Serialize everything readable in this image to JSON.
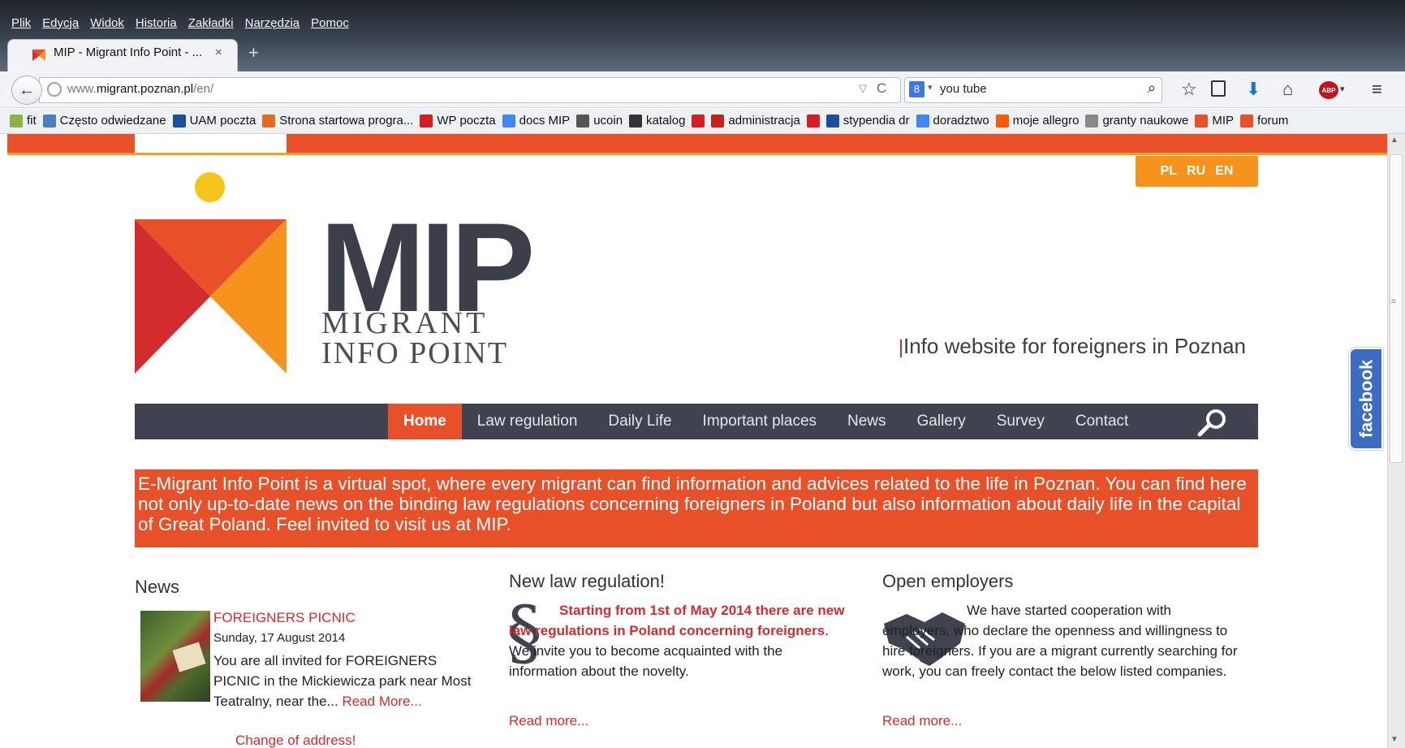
{
  "menubar": [
    "Plik",
    "Edycja",
    "Widok",
    "Historia",
    "Zakładki",
    "Narzędzia",
    "Pomoc"
  ],
  "tab": {
    "title": "MIP - Migrant Info Point - ...",
    "close": "×",
    "new_tab": "+"
  },
  "nav": {
    "back": "←",
    "url_prefix": "www.",
    "url_host": "migrant.poznan.pl",
    "url_path": "/en/",
    "url_dropdown": "▽",
    "reload": "C",
    "search_engine": "8",
    "search_value": "you tube"
  },
  "toolbar_icons": {
    "star": "☆",
    "download": "⬇",
    "home": "⌂",
    "abp": "ABP",
    "menu": "≡",
    "search": "⌕"
  },
  "bookmarks": [
    {
      "label": "fit",
      "color": "#8bb34a"
    },
    {
      "label": "Często odwiedzane",
      "color": "#4a7fc1"
    },
    {
      "label": "UAM poczta",
      "color": "#1f4d9a"
    },
    {
      "label": "Strona startowa progra...",
      "color": "#e46b1b"
    },
    {
      "label": "WP poczta",
      "color": "#d81e25"
    },
    {
      "label": "docs MIP",
      "color": "#4285f4"
    },
    {
      "label": "ucoin",
      "color": "#555555"
    },
    {
      "label": "katalog",
      "color": "#333333"
    },
    {
      "label": "",
      "color": "#d81e25"
    },
    {
      "label": "administracja",
      "color": "#c5221f"
    },
    {
      "label": "",
      "color": "#d81e25"
    },
    {
      "label": "stypendia dr",
      "color": "#1f4d9a"
    },
    {
      "label": "doradztwo",
      "color": "#4285f4"
    },
    {
      "label": "moje allegro",
      "color": "#ff5a00"
    },
    {
      "label": "granty naukowe",
      "color": "#888888"
    },
    {
      "label": "MIP",
      "color": "#e8502a"
    },
    {
      "label": "forum",
      "color": "#e8502a"
    }
  ],
  "page": {
    "languages": [
      "PL",
      "RU",
      "EN"
    ],
    "logo": {
      "title": "MIP",
      "line1": "MIGRANT",
      "line2": "INFO POINT"
    },
    "tagline": "Info website for foreigners in Poznan",
    "menu": [
      "Home",
      "Law regulation",
      "Daily Life",
      "Important places",
      "News",
      "Gallery",
      "Survey",
      "Contact"
    ],
    "intro": "E-Migrant Info Point is a virtual spot, where every migrant can find information and advices related to the life in Poznan. You can find here not only up-to-date news on the binding law regulations concerning foreigners in Poland but also information about daily life in the capital of Great Poland. Feel invited to visit us at MIP.",
    "news": {
      "heading": "News",
      "item_title": "FOREIGNERS PICNIC",
      "item_date": "Sunday, 17 August 2014",
      "item_body": "You are all invited for FOREIGNERS PICNIC in the Mickiewicza park near Most Teatralny, near the...",
      "item_more": "Read More...",
      "item2_title": "Change of address!"
    },
    "law": {
      "heading": "New law regulation!",
      "icon": "§",
      "strong": "Starting from 1st of May 2014 there are new law regulations in Poland concerning foreigners",
      "rest": ". We invite you to become acquainted with the information about the novelty.",
      "more": "Read more..."
    },
    "employers": {
      "heading": "Open employers",
      "body": "We have started cooperation with employers, who declare the openness and willingness to hire foreigners. If you are a migrant currently searching for work, you can freely contact the below listed companies.",
      "more": "Read more..."
    },
    "facebook": "facebook"
  },
  "colors": {
    "accent": "#e8502a",
    "nav_dark": "#3e434f",
    "lang_orange": "#f6931c",
    "yellow": "#f6c51b",
    "link_red": "#d42c2c"
  }
}
